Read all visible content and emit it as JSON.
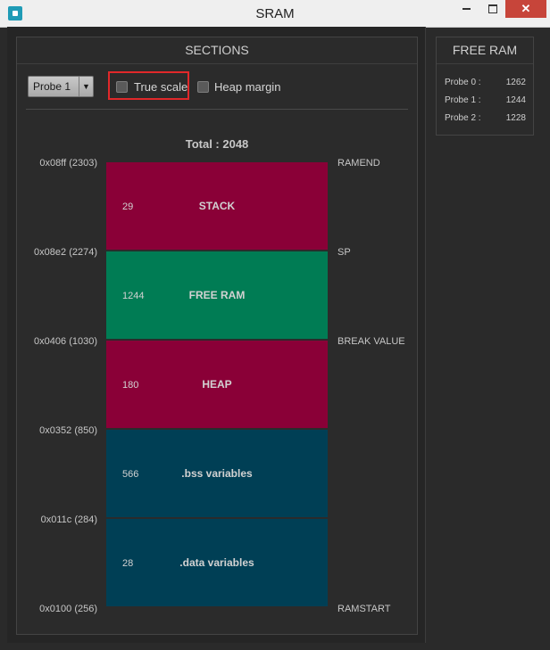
{
  "window": {
    "title": "SRAM"
  },
  "sections": {
    "header": "SECTIONS",
    "probe_select": "Probe 1",
    "true_scale_label": "True scale",
    "heap_margin_label": "Heap margin",
    "total": "Total : 2048",
    "addresses": [
      "0x08ff (2303)",
      "0x08e2 (2274)",
      "0x0406 (1030)",
      "0x0352 (850)",
      "0x011c (284)",
      "0x0100 (256)"
    ],
    "boundary_labels": [
      "RAMEND",
      "SP",
      "BREAK VALUE",
      "RAMSTART"
    ],
    "blocks": [
      {
        "size": "29",
        "name": "STACK",
        "color": "#8a0037"
      },
      {
        "size": "1244",
        "name": "FREE RAM",
        "color": "#007c54"
      },
      {
        "size": "180",
        "name": "HEAP",
        "color": "#8a0037"
      },
      {
        "size": "566",
        "name": ".bss variables",
        "color": "#003f55"
      },
      {
        "size": "28",
        "name": ".data variables",
        "color": "#003f55"
      }
    ]
  },
  "free_ram": {
    "header": "FREE RAM",
    "rows": [
      {
        "label": "Probe 0 :",
        "value": "1262"
      },
      {
        "label": "Probe 1 :",
        "value": "1244"
      },
      {
        "label": "Probe 2 :",
        "value": "1228"
      }
    ]
  }
}
